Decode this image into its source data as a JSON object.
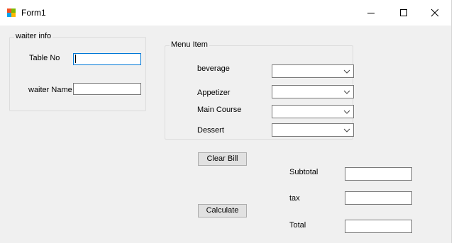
{
  "window": {
    "title": "Form1"
  },
  "icons": {
    "app": "windows-form-icon",
    "minimize": "minimize-icon",
    "maximize": "maximize-icon",
    "close": "close-icon",
    "dropdown": "chevron-down-icon"
  },
  "waiter_info": {
    "legend": "waiter info",
    "table_no_label": "Table No",
    "table_no_value": "",
    "waiter_name_label": "waiter Name",
    "waiter_name_value": ""
  },
  "menu": {
    "legend": "Menu Item",
    "items": [
      {
        "label": "beverage",
        "selected": ""
      },
      {
        "label": "Appetizer",
        "selected": ""
      },
      {
        "label": "Main Course",
        "selected": ""
      },
      {
        "label": "Dessert",
        "selected": ""
      }
    ]
  },
  "buttons": {
    "clear_bill": "Clear Bill",
    "calculate": "Calculate"
  },
  "totals": {
    "subtotal_label": "Subtotal",
    "subtotal_value": "",
    "tax_label": "tax",
    "tax_value": "",
    "total_label": "Total",
    "total_value": ""
  },
  "colors": {
    "window_bg": "#f0f0f0",
    "focus_border": "#0078d7"
  }
}
